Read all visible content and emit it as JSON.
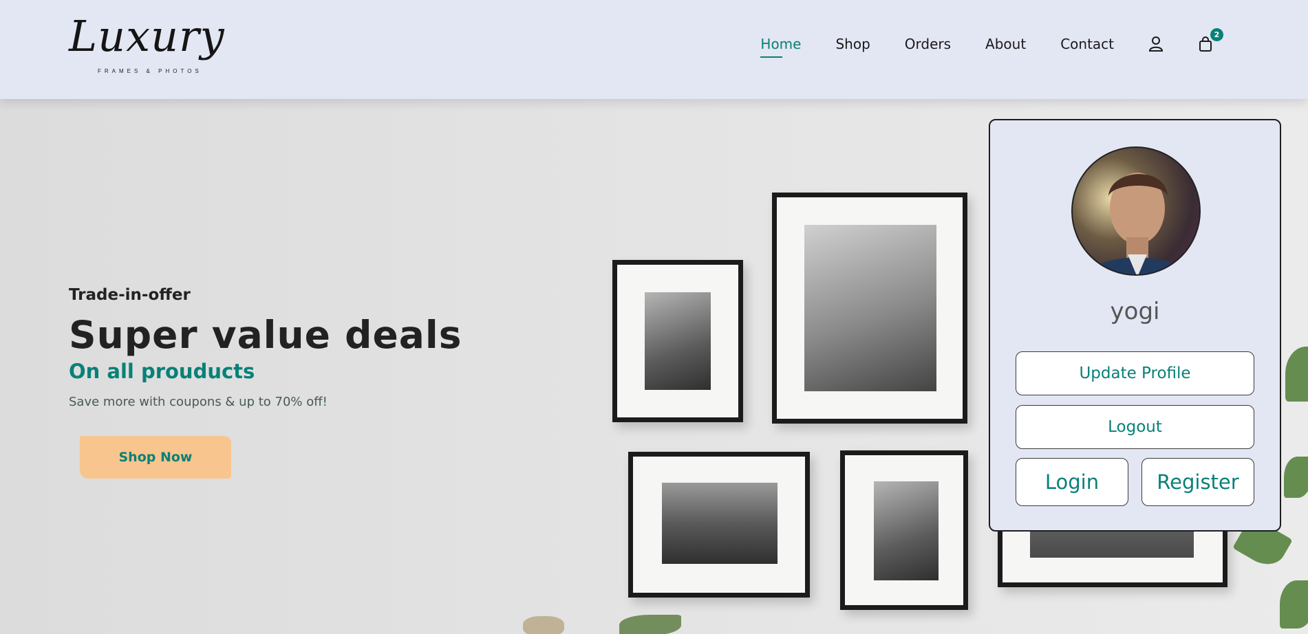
{
  "brand": {
    "logo_text": "Luxury",
    "logo_subtext": "FRAMES & PHOTOS"
  },
  "nav": {
    "items": [
      {
        "label": "Home",
        "active": true
      },
      {
        "label": "Shop",
        "active": false
      },
      {
        "label": "Orders",
        "active": false
      },
      {
        "label": "About",
        "active": false
      },
      {
        "label": "Contact",
        "active": false
      }
    ],
    "user_icon": "user-icon",
    "cart_icon": "shopping-bag-icon",
    "cart_count": "2"
  },
  "hero": {
    "eyebrow": "Trade-in-offer",
    "title": "Super value deals",
    "subtitle": "On all prouducts",
    "description": "Save more with coupons & up to 70% off!",
    "cta_label": "Shop Now"
  },
  "profile_card": {
    "username": "yogi",
    "update_profile_label": "Update Profile",
    "logout_label": "Logout",
    "login_label": "Login",
    "register_label": "Register"
  },
  "colors": {
    "accent": "#088178",
    "header_bg": "#e3e6f3",
    "cta_bg": "#f8c58e"
  }
}
